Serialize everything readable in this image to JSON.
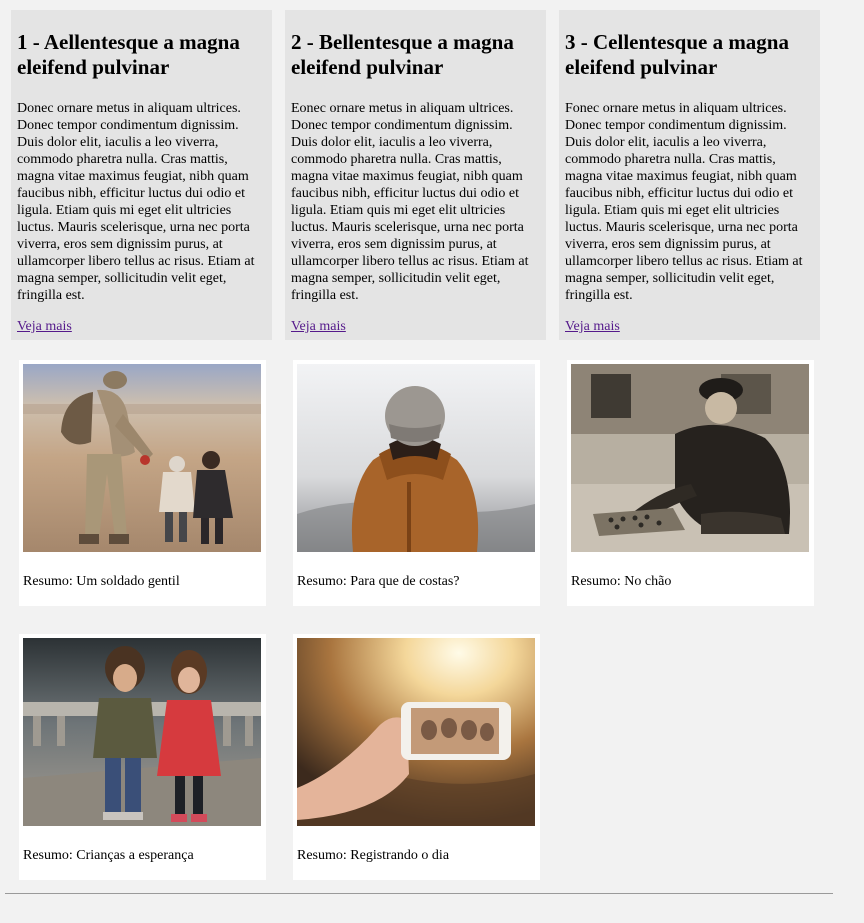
{
  "articles": [
    {
      "title": "1 - Aellentesque a magna eleifend pulvinar",
      "body": "Donec ornare metus in aliquam ultrices. Donec tempor condimentum dignissim. Duis dolor elit, iaculis a leo viverra, commodo pharetra nulla. Cras mattis, magna vitae maximus feugiat, nibh quam faucibus nibh, efficitur luctus dui odio et ligula. Etiam quis mi eget elit ultricies luctus. Mauris scelerisque, urna nec porta viverra, eros sem dignissim purus, at ullamcorper libero tellus ac risus. Etiam at magna semper, sollicitudin velit eget, fringilla est.",
      "link": "Veja mais"
    },
    {
      "title": "2 - Bellentesque a magna eleifend pulvinar",
      "body": "Eonec ornare metus in aliquam ultrices. Donec tempor condimentum dignissim. Duis dolor elit, iaculis a leo viverra, commodo pharetra nulla. Cras mattis, magna vitae maximus feugiat, nibh quam faucibus nibh, efficitur luctus dui odio et ligula. Etiam quis mi eget elit ultricies luctus. Mauris scelerisque, urna nec porta viverra, eros sem dignissim purus, at ullamcorper libero tellus ac risus. Etiam at magna semper, sollicitudin velit eget, fringilla est.",
      "link": "Veja mais"
    },
    {
      "title": "3 - Cellentesque a magna eleifend pulvinar",
      "body": "Fonec ornare metus in aliquam ultrices. Donec tempor condimentum dignissim. Duis dolor elit, iaculis a leo viverra, commodo pharetra nulla. Cras mattis, magna vitae maximus feugiat, nibh quam faucibus nibh, efficitur luctus dui odio et ligula. Etiam quis mi eget elit ultricies luctus. Mauris scelerisque, urna nec porta viverra, eros sem dignissim purus, at ullamcorper libero tellus ac risus. Etiam at magna semper, sollicitudin velit eget, fringilla est.",
      "link": "Veja mais"
    }
  ],
  "gallery": [
    {
      "caption": "Resumo: Um soldado gentil"
    },
    {
      "caption": "Resumo: Para que de costas?"
    },
    {
      "caption": "Resumo: No chão"
    },
    {
      "caption": "Resumo: Crianças a esperança"
    },
    {
      "caption": "Resumo: Registrando o dia"
    }
  ],
  "colors": {
    "page_background": "#f2f2f2",
    "article_background": "#e4e4e4",
    "card_background": "#ffffff",
    "link": "#551a8b",
    "rule": "#9a9a9a"
  }
}
